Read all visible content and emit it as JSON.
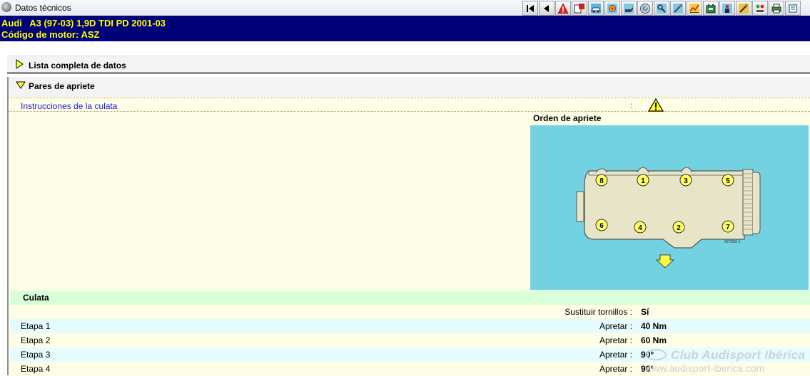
{
  "window": {
    "title": "Datos técnicos"
  },
  "toolbar": {
    "buttons": [
      {
        "icon": "first-page-icon"
      },
      {
        "icon": "back-icon"
      },
      {
        "icon": "warning-icon"
      },
      {
        "icon": "document-icon"
      },
      {
        "icon": "car-icon"
      },
      {
        "icon": "engine-icon"
      },
      {
        "icon": "oil-can-icon"
      },
      {
        "icon": "gauge-icon"
      },
      {
        "icon": "wrench-icon"
      },
      {
        "icon": "spanner-icon"
      },
      {
        "icon": "chart-icon"
      },
      {
        "icon": "battery-icon"
      },
      {
        "icon": "person-icon"
      },
      {
        "icon": "tool-icon"
      },
      {
        "icon": "settings-icon"
      },
      {
        "icon": "print-icon"
      },
      {
        "icon": "manual-icon"
      }
    ]
  },
  "vehicle": {
    "line1": "Audi   A3 (97-03) 1,9D TDI PD 2001-03",
    "line2": "Código de motor: ASZ"
  },
  "sections": {
    "complete_list": {
      "label": "Lista completa de datos"
    },
    "torque": {
      "label": "Pares de apriete",
      "instructions_link": "Instrucciones de la culata",
      "instructions_colon": ":",
      "diagram_title": "Orden de apriete",
      "diagram_code": "AD7580-1",
      "bolt_numbers_top": [
        "8",
        "1",
        "3",
        "5"
      ],
      "bolt_numbers_bottom": [
        "6",
        "4",
        "2",
        "7"
      ]
    }
  },
  "culata": {
    "heading": "Culata",
    "rows": [
      {
        "label": "",
        "key": "Sustituir tornillos :",
        "value": "Sí"
      },
      {
        "label": "Etapa 1",
        "key": "Apretar :",
        "value": "40 Nm"
      },
      {
        "label": "Etapa 2",
        "key": "Apretar :",
        "value": "60 Nm"
      },
      {
        "label": "Etapa 3",
        "key": "Apretar :",
        "value": "90°"
      },
      {
        "label": "Etapa 4",
        "key": "Apretar :",
        "value": "90°"
      }
    ]
  },
  "watermark": {
    "line1": "Club Audisport Ibérica",
    "line2": "www.audisport-iberica.com"
  },
  "colors": {
    "header_bg": "#000078",
    "header_text": "#ffff00",
    "section_bg": "#fefee6",
    "diagram_bg": "#72d2e1",
    "subhead_bg": "#d8ffd8",
    "row_alt_bg": "#e6fbfe",
    "link": "#1a1ad6"
  }
}
